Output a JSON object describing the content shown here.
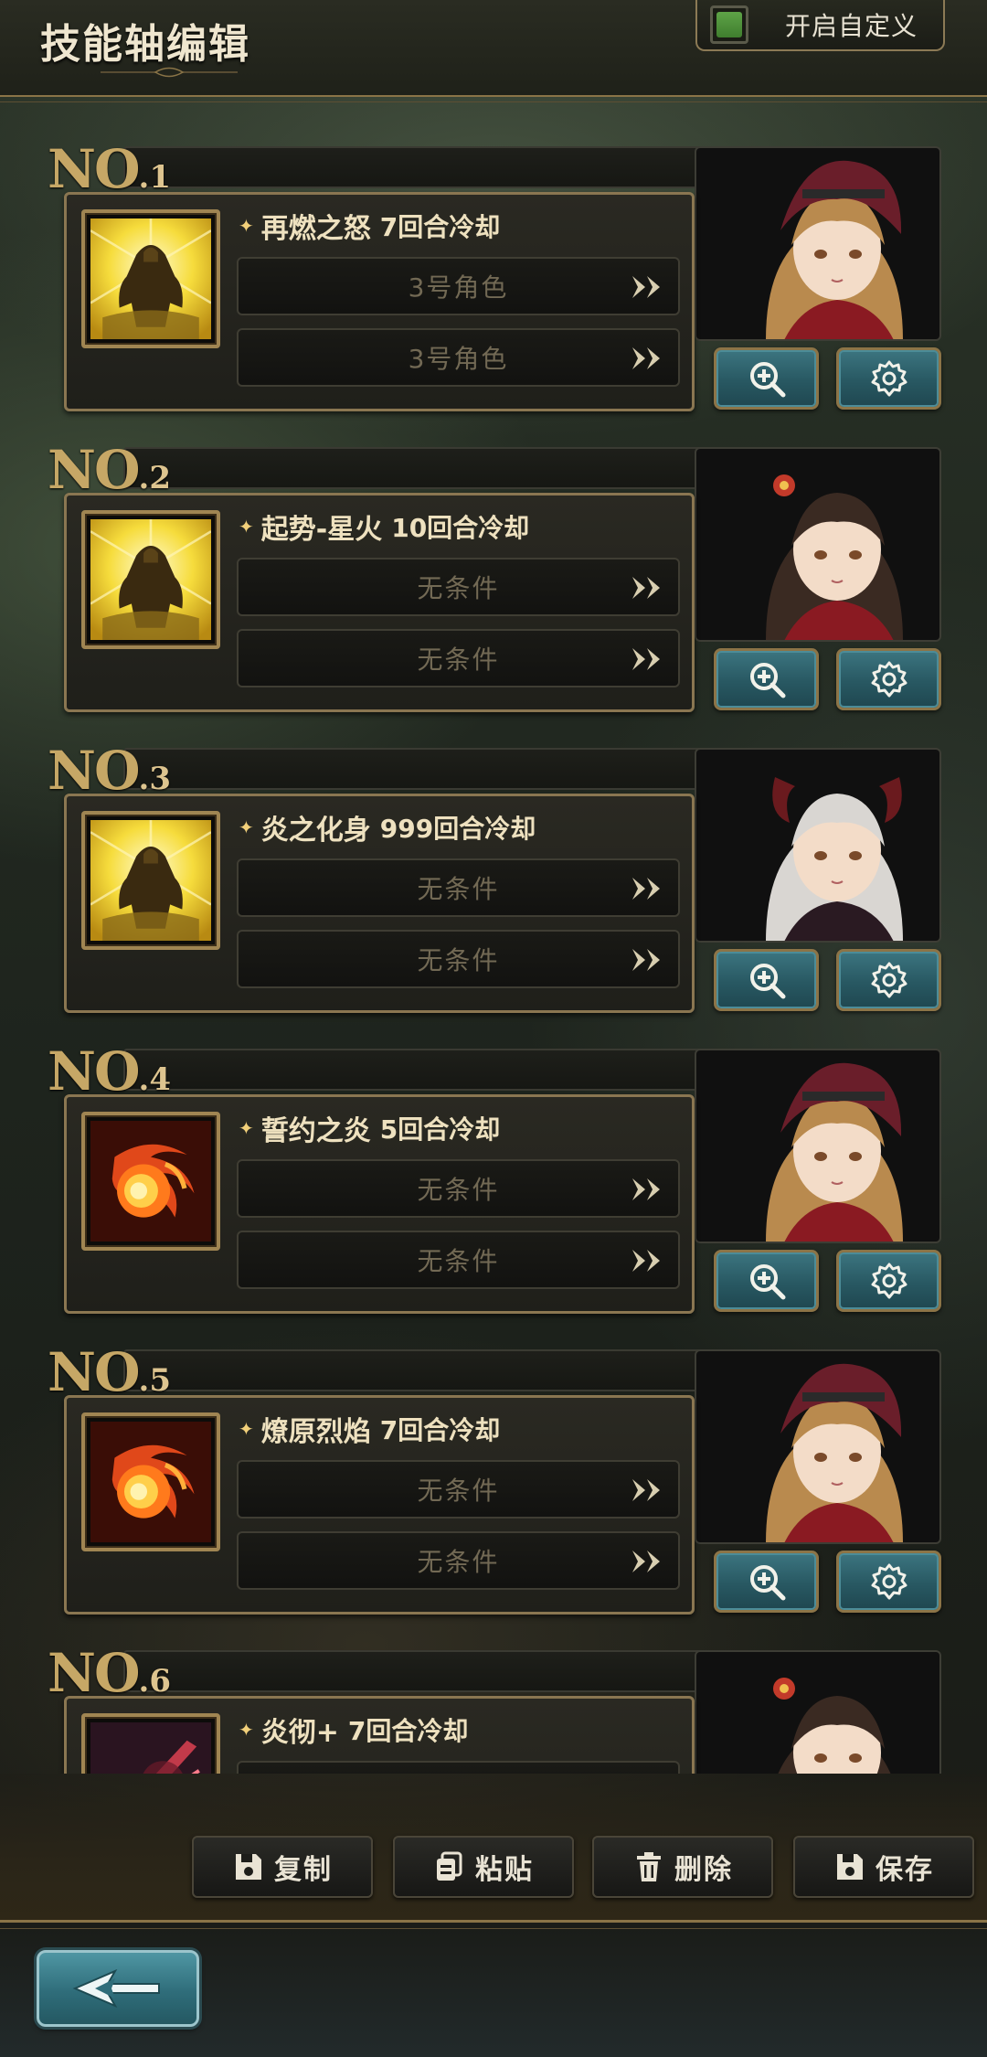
{
  "header": {
    "title": "技能轴编辑",
    "custom_toggle": {
      "label": "开启自定义",
      "checked": true,
      "color": "#4f9a3c"
    }
  },
  "entries": [
    {
      "no_prefix": "N",
      "no_o": "O",
      "number": ".1",
      "skill_name": "再燃之怒",
      "cooldown": "7回合冷却",
      "icon": "golden-warrior-icon",
      "portrait": "red-hood-girl",
      "conditions": [
        "3号角色",
        "3号角色"
      ]
    },
    {
      "no_prefix": "N",
      "no_o": "O",
      "number": ".2",
      "skill_name": "起势-星火",
      "cooldown": "10回合冷却",
      "icon": "golden-warrior-icon",
      "portrait": "dark-hair-flower-girl",
      "conditions": [
        "无条件",
        "无条件"
      ]
    },
    {
      "no_prefix": "N",
      "no_o": "O",
      "number": ".3",
      "skill_name": "炎之化身",
      "cooldown": "999回合冷却",
      "icon": "golden-warrior-icon",
      "portrait": "white-hair-horned-girl",
      "conditions": [
        "无条件",
        "无条件"
      ]
    },
    {
      "no_prefix": "N",
      "no_o": "O",
      "number": ".4",
      "skill_name": "誓约之炎",
      "cooldown": "5回合冷却",
      "icon": "fireball-icon",
      "portrait": "red-hood-girl",
      "conditions": [
        "无条件",
        "无条件"
      ]
    },
    {
      "no_prefix": "N",
      "no_o": "O",
      "number": ".5",
      "skill_name": "燎原烈焰",
      "cooldown": "7回合冷却",
      "icon": "fireball-icon",
      "portrait": "red-hood-girl",
      "conditions": [
        "无条件",
        "无条件"
      ]
    },
    {
      "no_prefix": "N",
      "no_o": "O",
      "number": ".6",
      "skill_name": "炎彻+",
      "cooldown": "7回合冷却",
      "icon": "sword-slash-icon",
      "portrait": "dark-hair-flower-girl",
      "conditions": [
        "",
        ""
      ]
    }
  ],
  "actions": {
    "copy": "复制",
    "paste": "粘贴",
    "delete": "删除",
    "save": "保存"
  },
  "colors": {
    "accent_gold": "#8a7651",
    "button_teal": "#2f6d7a",
    "text_light": "#eee1bf",
    "condition_text": "#726954"
  }
}
